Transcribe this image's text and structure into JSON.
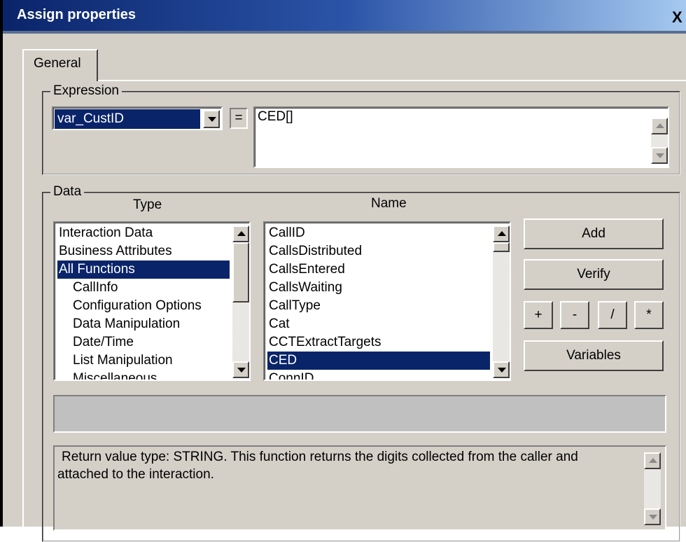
{
  "window": {
    "title": "Assign properties",
    "close_label": "X"
  },
  "tabs": [
    {
      "label": "General"
    }
  ],
  "expression": {
    "group_label": "Expression",
    "variable_value": "var_CustID",
    "equals_label": "=",
    "expression_text": "CED[]"
  },
  "data": {
    "group_label": "Data",
    "type_header": "Type",
    "name_header": "Name",
    "type_items": [
      {
        "label": "Interaction Data",
        "indent": false,
        "selected": false
      },
      {
        "label": "Business Attributes",
        "indent": false,
        "selected": false
      },
      {
        "label": "All Functions",
        "indent": false,
        "selected": true
      },
      {
        "label": "CallInfo",
        "indent": true,
        "selected": false
      },
      {
        "label": "Configuration Options",
        "indent": true,
        "selected": false
      },
      {
        "label": "Data Manipulation",
        "indent": true,
        "selected": false
      },
      {
        "label": "Date/Time",
        "indent": true,
        "selected": false
      },
      {
        "label": "List Manipulation",
        "indent": true,
        "selected": false
      },
      {
        "label": "Miscellaneous",
        "indent": true,
        "selected": false
      }
    ],
    "name_items": [
      {
        "label": "CallID",
        "selected": false
      },
      {
        "label": "CallsDistributed",
        "selected": false
      },
      {
        "label": "CallsEntered",
        "selected": false
      },
      {
        "label": "CallsWaiting",
        "selected": false
      },
      {
        "label": "CallType",
        "selected": false
      },
      {
        "label": "Cat",
        "selected": false
      },
      {
        "label": "CCTExtractTargets",
        "selected": false
      },
      {
        "label": "CED",
        "selected": true
      },
      {
        "label": "ConnID",
        "selected": false
      }
    ]
  },
  "buttons": {
    "add": "Add",
    "verify": "Verify",
    "plus": "+",
    "minus": "-",
    "divide": "/",
    "multiply": "*",
    "variables": "Variables"
  },
  "status_field": "",
  "description": "Return value type: STRING. This function returns the digits collected from the caller and attached to the interaction.",
  "colors": {
    "selection": "#0a246a",
    "face": "#d4d0c8",
    "title_start": "#0a246a"
  },
  "icons": [
    "close-icon",
    "chevron-down-icon",
    "scroll-up-icon",
    "scroll-down-icon"
  ]
}
